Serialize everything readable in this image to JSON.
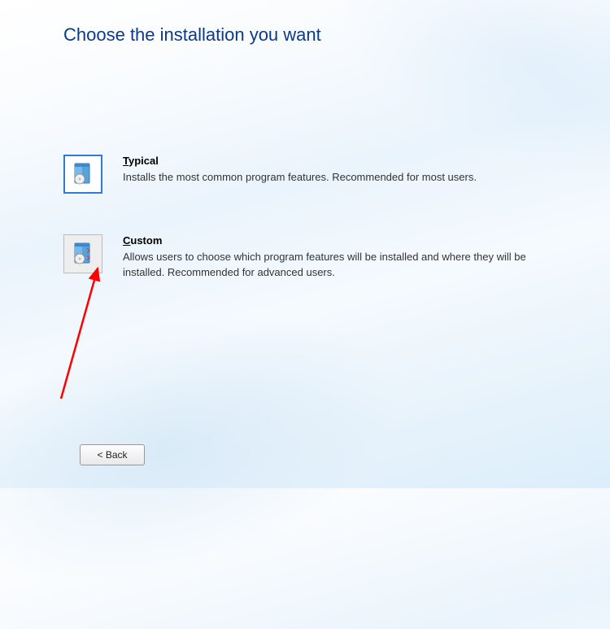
{
  "title": "Choose the installation you want",
  "options": {
    "typical": {
      "title_prefix": "T",
      "title_rest": "ypical",
      "description": "Installs the most common program features. Recommended for most users."
    },
    "custom": {
      "title_prefix": "C",
      "title_rest": "ustom",
      "description": "Allows users to choose which program features will be installed and where they will be installed. Recommended for advanced users."
    }
  },
  "buttons": {
    "back": "< Back"
  }
}
